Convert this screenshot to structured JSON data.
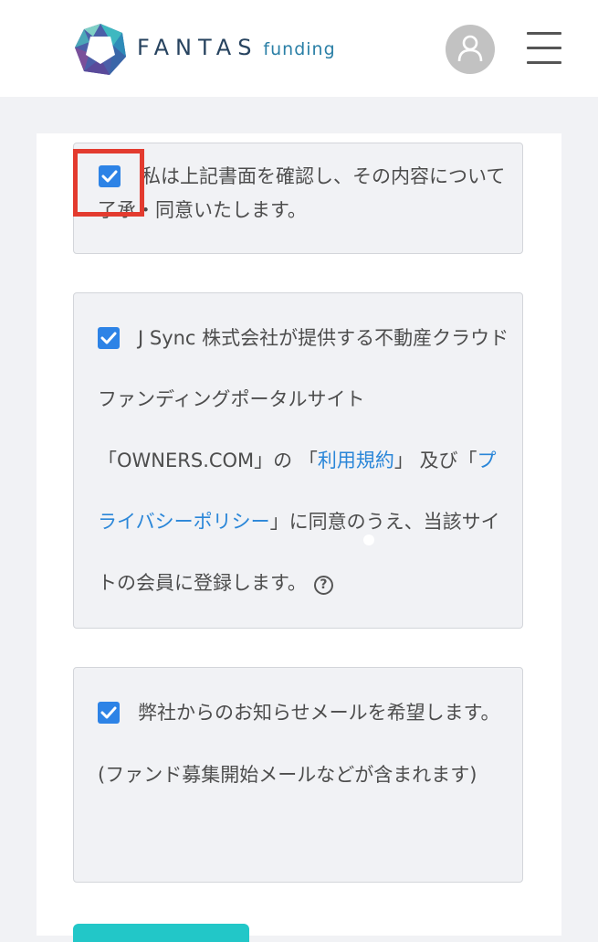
{
  "header": {
    "logo_main": "FANTAS",
    "logo_sub": "funding",
    "avatar_icon": "user-icon",
    "menu_icon": "hamburger-menu-icon"
  },
  "consent_document": {
    "checked": true,
    "text": "私は上記書面を確認し、その内容について了承・同意いたします。"
  },
  "consent_terms": {
    "checked": true,
    "text_1": "J Sync 株式会社が提供する不動産クラウドファンディングポータルサイト「OWNERS.COM」の 「",
    "terms_link": "利用規約",
    "text_2": "」 及び「",
    "privacy_link": "プライバシーポリシー",
    "text_3": "」に同意のうえ、当該サイトの会員に登録します。",
    "help_symbol": "?"
  },
  "consent_newsletter": {
    "checked": true,
    "text": "弊社からのお知らせメールを希望します。(ファンド募集開始メールなどが含まれます)"
  },
  "colors": {
    "checkbox": "#2d83e6",
    "link": "#2a86d8",
    "highlight": "#e33b2f",
    "button": "#22c7c8"
  }
}
